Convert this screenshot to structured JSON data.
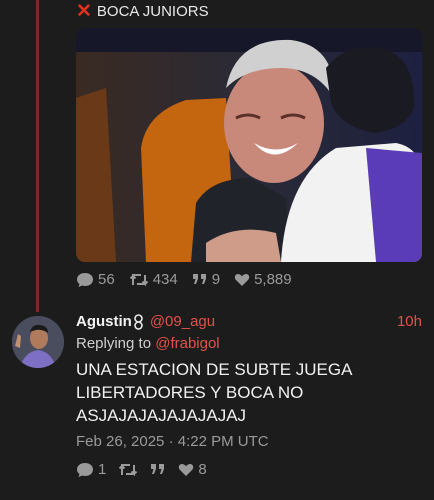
{
  "previous_tweet": {
    "text": "BOCA JUNIORS",
    "stats": {
      "replies": "56",
      "retweets": "434",
      "quotes": "9",
      "likes": "5,889"
    }
  },
  "tweet": {
    "display_name": "Agustin",
    "handle": "@09_agu",
    "time_ago": "10h",
    "replying_label": "Replying to",
    "replying_to": "@frabigol",
    "text_lines": [
      "UNA ESTACION DE SUBTE JUEGA",
      "LIBERTADORES Y BOCA NO",
      "ASJAJAJAJAJAJAJAJ"
    ],
    "date": "Feb 26, 2025 · 4:22 PM UTC",
    "stats": {
      "replies": "1",
      "retweets": "",
      "quotes": "",
      "likes": "8"
    }
  },
  "colors": {
    "accent": "#e0524a",
    "thread_line": "#7a2a2a",
    "background": "#1c1c1c",
    "x_mark": "#e0301e"
  },
  "icons": {
    "previous_tweet": "cross-mark-icon",
    "display_name": "infinity-icon"
  }
}
